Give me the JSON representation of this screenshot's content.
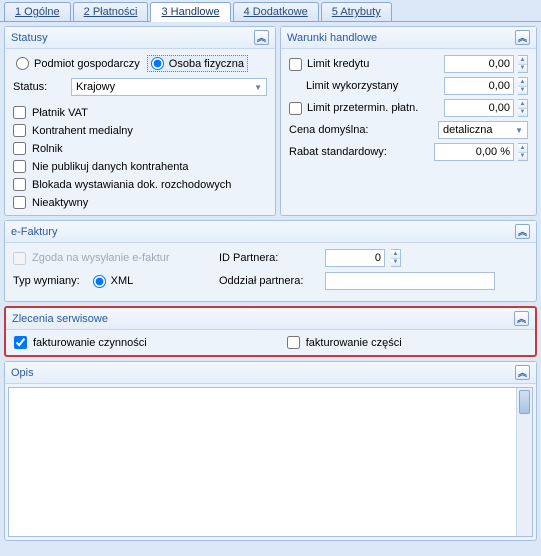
{
  "tabs": {
    "t1": "1 Ogólne",
    "t2": "2 Płatności",
    "t3": "3 Handlowe",
    "t4": "4 Dodatkowe",
    "t5": "5 Atrybuty"
  },
  "collapse_glyph": "︽",
  "statusy": {
    "title": "Statusy",
    "podmiot": "Podmiot gospodarczy",
    "osoba": "Osoba fizyczna",
    "status_label": "Status:",
    "status_value": "Krajowy",
    "checks": {
      "platnik": "Płatnik VAT",
      "medialny": "Kontrahent medialny",
      "rolnik": "Rolnik",
      "niepub": "Nie publikuj danych kontrahenta",
      "blokada": "Blokada wystawiania dok. rozchodowych",
      "nieaktywny": "Nieaktywny"
    }
  },
  "warunki": {
    "title": "Warunki handlowe",
    "limit_kredytu": "Limit kredytu",
    "limit_kredytu_val": "0,00",
    "limit_wyk": "Limit wykorzystany",
    "limit_wyk_val": "0,00",
    "limit_prz": "Limit przetermin. płatn.",
    "limit_prz_val": "0,00",
    "cena": "Cena domyślna:",
    "cena_val": "detaliczna",
    "rabat": "Rabat standardowy:",
    "rabat_val": "0,00 %"
  },
  "efaktury": {
    "title": "e-Faktury",
    "zgoda": "Zgoda na wysyłanie e-faktur",
    "idpartnera": "ID Partnera:",
    "idpartnera_val": "0",
    "typ": "Typ wymiany:",
    "xml": "XML",
    "oddzial": "Oddział partnera:"
  },
  "zlecenia": {
    "title": "Zlecenia serwisowe",
    "fakt_czyn": "fakturowanie czynności",
    "fakt_czesci": "fakturowanie części"
  },
  "opis": {
    "title": "Opis"
  }
}
